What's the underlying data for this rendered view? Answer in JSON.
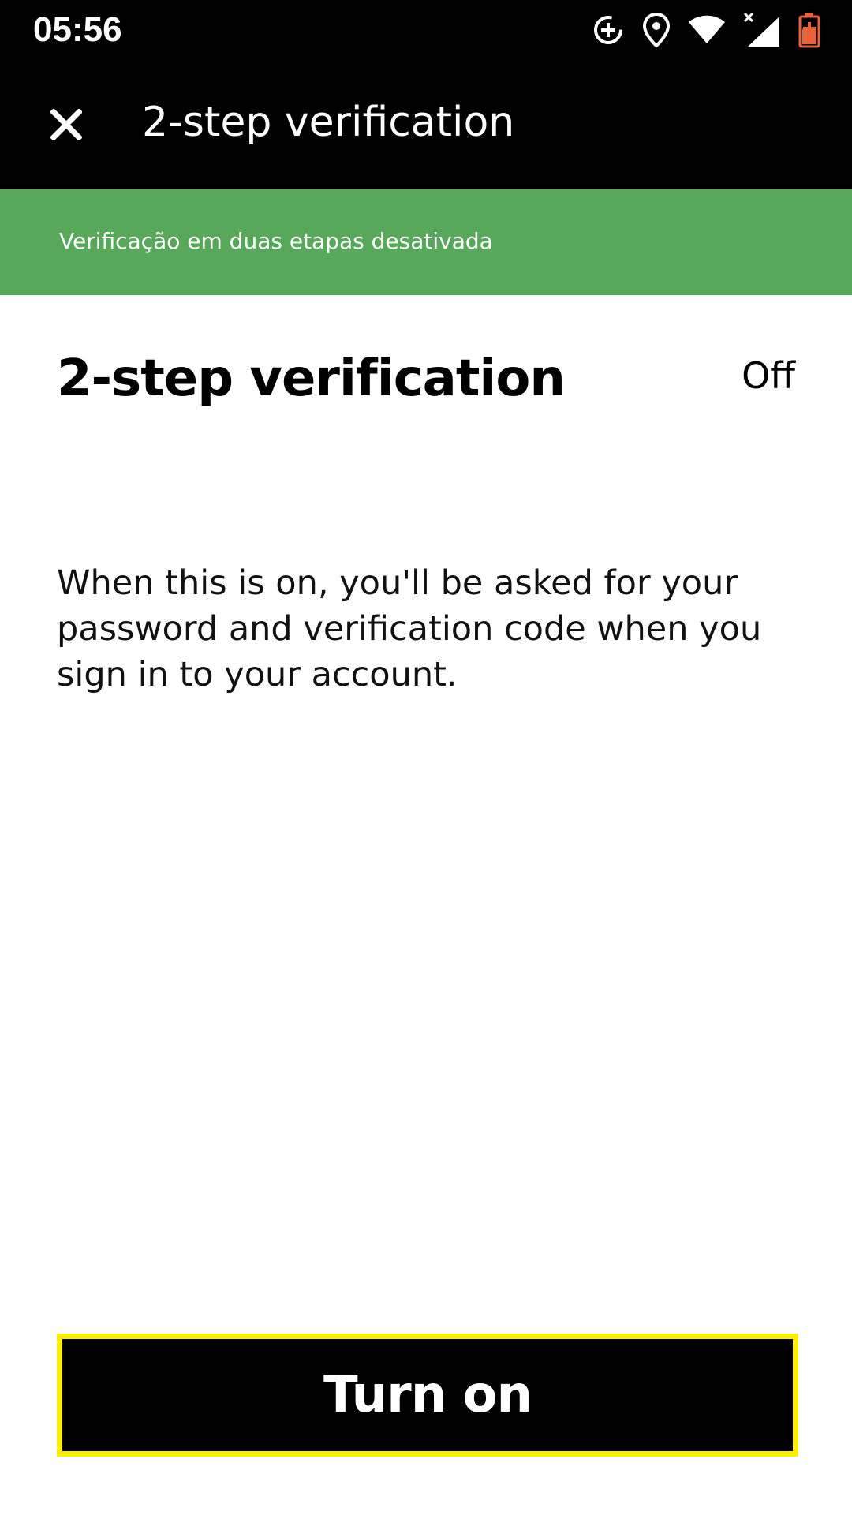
{
  "status_bar": {
    "time": "05:56",
    "icons": [
      "data-saver-icon",
      "location-icon",
      "wifi-icon",
      "signal-no-data-icon",
      "battery-charging-icon"
    ]
  },
  "toolbar": {
    "close_icon": "close-icon",
    "title": "2-step verification"
  },
  "banner": {
    "text": "Verificação em duas etapas desativada",
    "color": "#57a85a"
  },
  "setting": {
    "title": "2-step verification",
    "status": "Off",
    "description": "When this is on, you'll be asked for your password and verification code when you sign in to your account."
  },
  "action": {
    "turn_on_label": "Turn on",
    "focus_color": "#ffee00"
  }
}
